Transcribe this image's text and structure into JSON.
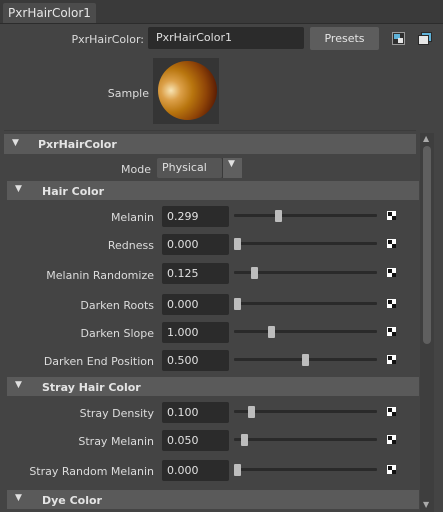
{
  "tab": {
    "label": "PxrHairColor1"
  },
  "node": {
    "label": "PxrHairColor:",
    "value": "PxrHairColor1",
    "presets_label": "Presets",
    "sample_label": "Sample"
  },
  "sections": {
    "main": {
      "title": "PxrHairColor",
      "mode_label": "Mode",
      "mode_value": "Physical"
    },
    "hair_color": {
      "title": "Hair Color"
    },
    "stray": {
      "title": "Stray Hair Color"
    },
    "dye": {
      "title": "Dye Color"
    }
  },
  "params": [
    {
      "label": "Melanin",
      "value": "0.299",
      "slider": 0.299
    },
    {
      "label": "Redness",
      "value": "0.000",
      "slider": 0.0
    },
    {
      "label": "Melanin Randomize",
      "value": "0.125",
      "slider": 0.125
    },
    {
      "label": "Darken Roots",
      "value": "0.000",
      "slider": 0.0
    },
    {
      "label": "Darken Slope",
      "value": "1.000",
      "slider": 0.25
    },
    {
      "label": "Darken End Position",
      "value": "0.500",
      "slider": 0.5
    },
    {
      "label": "Stray Density",
      "value": "0.100",
      "slider": 0.1
    },
    {
      "label": "Stray Melanin",
      "value": "0.050",
      "slider": 0.05
    },
    {
      "label": "Stray Random Melanin",
      "value": "0.000",
      "slider": 0.0
    }
  ],
  "icons": {
    "save_attr": "attribute-save-icon",
    "copy_tab": "copy-tab-icon",
    "map": "checker-map-icon",
    "collapse": "triangle-down-icon",
    "dropdown": "chevron-down-icon"
  },
  "colors": {
    "panel_bg": "#444444",
    "section_header": "#5a5a5a",
    "field_bg": "#2b2b2b",
    "accent": "#5fb2d8"
  }
}
